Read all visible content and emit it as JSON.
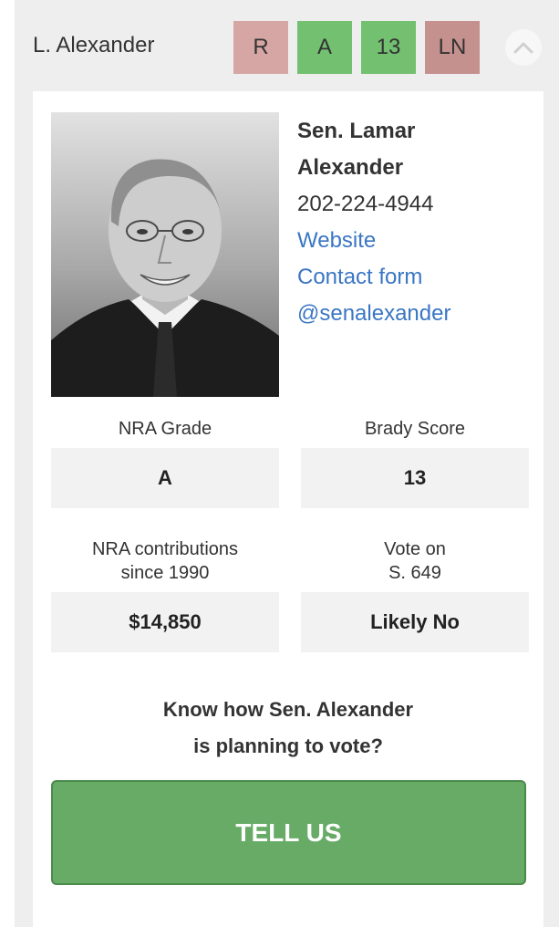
{
  "header": {
    "name": "L. Alexander",
    "tags": {
      "party": "R",
      "nra_grade": "A",
      "brady_score": "13",
      "vote": "LN"
    },
    "toggle_icon": "chevron-up-icon"
  },
  "profile": {
    "full_name_line1": "Sen. Lamar",
    "full_name_line2": "Alexander",
    "phone": "202-224-4944",
    "website_label": "Website",
    "contact_form_label": "Contact form",
    "twitter_label": "@senalexander"
  },
  "stats": {
    "nra_grade_label": "NRA Grade",
    "nra_grade_value": "A",
    "brady_label": "Brady Score",
    "brady_value": "13",
    "contrib_label_line1": "NRA contributions",
    "contrib_label_line2": "since 1990",
    "contrib_value": "$14,850",
    "vote_label_line1": "Vote on",
    "vote_label_line2": "S. 649",
    "vote_value": "Likely No"
  },
  "prompt": {
    "line1": "Know how Sen. Alexander",
    "line2": "is planning to vote?"
  },
  "cta": {
    "label": "TELL US"
  },
  "colors": {
    "party_tag": "#d6a6a5",
    "grade_tag": "#72c070",
    "vote_tag": "#c5918e",
    "link": "#3a76c4",
    "cta_bg": "#67ab67"
  }
}
